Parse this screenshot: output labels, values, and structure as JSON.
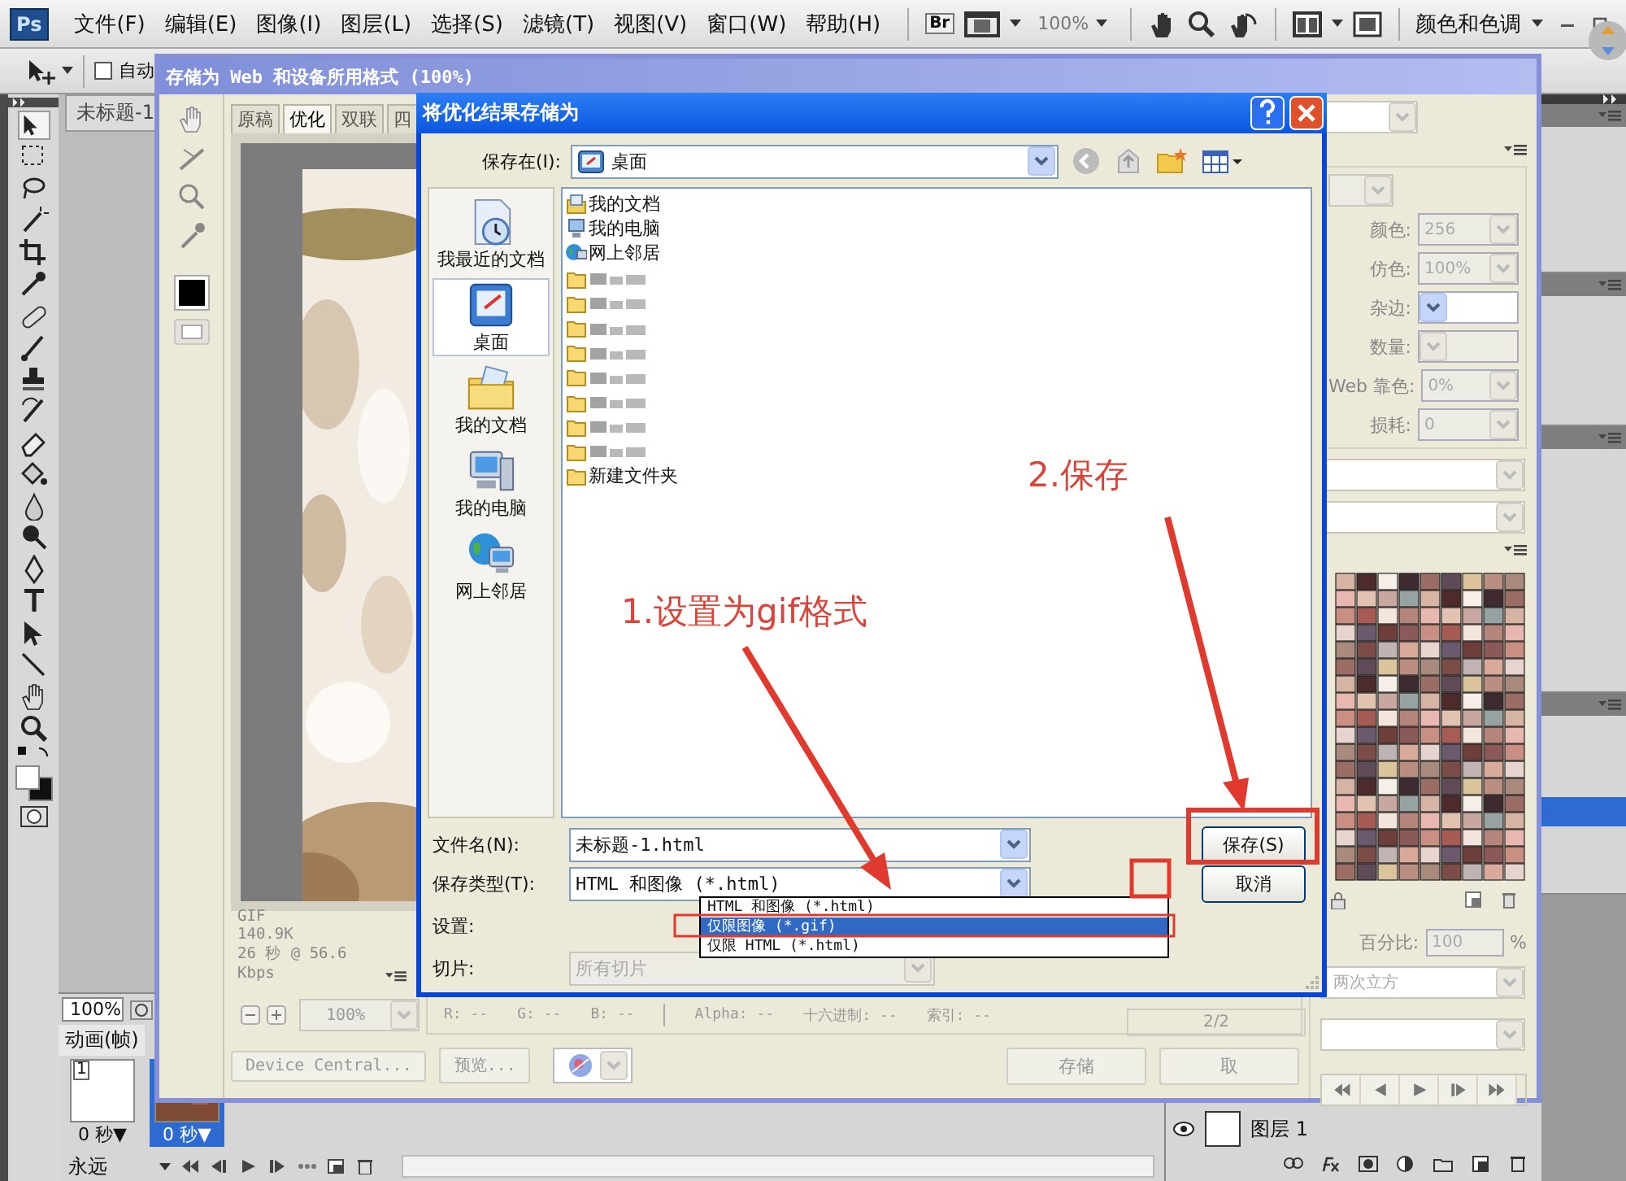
{
  "app": {
    "logo": "Ps",
    "menus": [
      "文件(F)",
      "编辑(E)",
      "图像(I)",
      "图层(L)",
      "选择(S)",
      "滤镜(T)",
      "视图(V)",
      "窗口(W)",
      "帮助(H)"
    ],
    "bridge": "Br",
    "zoom": "100%",
    "workspace": "颜色和色调",
    "auto_select": {
      "label": "自动",
      "checked": false
    },
    "doc_tab": "未标题-1"
  },
  "save_for_web": {
    "title": "存储为 Web 和设备所用格式 (100%)",
    "tabs": [
      {
        "label": "原稿",
        "selected": false
      },
      {
        "label": "优化",
        "selected": true
      },
      {
        "label": "双联",
        "selected": false
      },
      {
        "label": "四",
        "selected": false
      }
    ],
    "preview_info": [
      "GIF",
      "140.9K",
      "26 秒 @ 56.6 Kbps"
    ],
    "settings": [
      {
        "label": "颜色:",
        "value": "256",
        "disabled": true
      },
      {
        "label": "仿色:",
        "value": "100%",
        "disabled": true
      },
      {
        "label": "杂边:",
        "disabled": false
      },
      {
        "label": "数量:",
        "disabled": true
      },
      {
        "label": "Web 靠色:",
        "value": "0%",
        "disabled": true
      },
      {
        "label": "损耗:",
        "value": "0",
        "disabled": true
      }
    ],
    "percent": {
      "label": "百分比:",
      "value": "100",
      "unit": "%"
    },
    "resample": "两次立方",
    "frame_counter": "2/2",
    "zoom": "100%",
    "readouts": [
      "R: --",
      "G: --",
      "B: --",
      "Alpha: --",
      "十六进制: --",
      "索引: --"
    ],
    "buttons": [
      "Device Central...",
      "预览..."
    ],
    "save": "存储",
    "cancel": "取"
  },
  "dialog": {
    "title": "将优化结果存储为",
    "location_label": "保存在(I):",
    "location": "桌面",
    "places": [
      {
        "kind": "recent",
        "label": "我最近的文档",
        "selected": false
      },
      {
        "kind": "desktop",
        "label": "桌面",
        "selected": true
      },
      {
        "kind": "documents",
        "label": "我的文档",
        "selected": false
      },
      {
        "kind": "computer",
        "label": "我的电脑",
        "selected": false
      },
      {
        "kind": "network",
        "label": "网上邻居",
        "selected": false
      }
    ],
    "files": [
      {
        "kind": "documents",
        "name": "我的文档"
      },
      {
        "kind": "computer",
        "name": "我的电脑"
      },
      {
        "kind": "network",
        "name": "网上邻居"
      },
      {
        "kind": "blurred"
      },
      {
        "kind": "blurred"
      },
      {
        "kind": "blurred"
      },
      {
        "kind": "blurred"
      },
      {
        "kind": "blurred"
      },
      {
        "kind": "blurred"
      },
      {
        "kind": "blurred"
      },
      {
        "kind": "blurred"
      },
      {
        "kind": "folder",
        "name": "新建文件夹"
      }
    ],
    "filename_label": "文件名(N):",
    "filename": "未标题-1.html",
    "type_label": "保存类型(T):",
    "type": "HTML 和图像 (*.html)",
    "type_options": [
      {
        "label": "HTML 和图像 (*.html)",
        "selected": false
      },
      {
        "label": "仅限图像 (*.gif)",
        "selected": true
      },
      {
        "label": "仅限 HTML (*.html)",
        "selected": false
      }
    ],
    "settings_label": "设置:",
    "slices_label": "切片:",
    "slices": "所有切片",
    "slices_disabled": true,
    "save_button": "保存(S)",
    "cancel_button": "取消"
  },
  "animation": {
    "zoom": "100%",
    "title": "动画(帧)",
    "frames": [
      {
        "number": "1",
        "delay": "0 秒▼",
        "selected": false
      },
      {
        "delay": "0 秒▼",
        "selected": true
      }
    ],
    "loop": "永远"
  },
  "layers": {
    "layer": "图层 1"
  },
  "annotations": [
    {
      "kind": "step",
      "text": "1.设置为gif格式"
    },
    {
      "kind": "step",
      "text": "2.保存"
    }
  ]
}
